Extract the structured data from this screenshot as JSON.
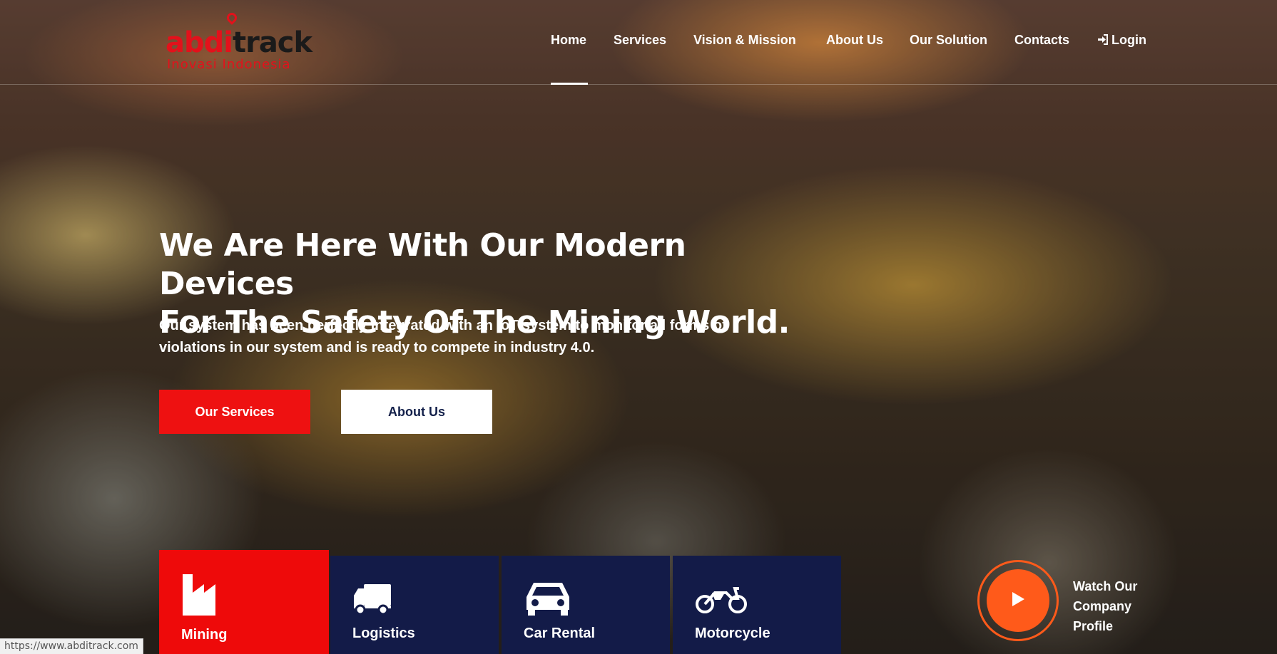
{
  "brand": {
    "logo_part1": "abdi",
    "logo_part2": "track",
    "tagline": "Inovasi Indonesia",
    "primary_color": "#ee1111",
    "navy_color": "#131b48",
    "accent_color": "#ff5a1a"
  },
  "nav": {
    "items": [
      {
        "label": "Home",
        "active": true
      },
      {
        "label": "Services"
      },
      {
        "label": "Vision & Mission"
      },
      {
        "label": "About Us"
      },
      {
        "label": "Our Solution"
      },
      {
        "label": "Contacts"
      },
      {
        "label": "Login",
        "icon": "login-icon"
      }
    ]
  },
  "hero": {
    "title_line1": "We Are Here With Our Modern Devices",
    "title_line2": "For The Safety Of The Mining World.",
    "desc_line1": "Our system has been perfectly integrated with an IoT system to monitor all forms of",
    "desc_line2": "violations in our system and is ready to compete in industry 4.0.",
    "primary_button": "Our Services",
    "secondary_button": "About Us"
  },
  "services": [
    {
      "label": "Mining",
      "icon": "factory-icon",
      "active": true
    },
    {
      "label": "Logistics",
      "icon": "truck-icon"
    },
    {
      "label": "Car Rental",
      "icon": "car-icon"
    },
    {
      "label": "Motorcycle",
      "icon": "motorcycle-icon"
    }
  ],
  "profile": {
    "line1": "Watch Our",
    "line2": "Company",
    "line3": "Profile",
    "icon": "play-icon"
  },
  "status_bar": {
    "url": "https://www.abditrack.com"
  }
}
